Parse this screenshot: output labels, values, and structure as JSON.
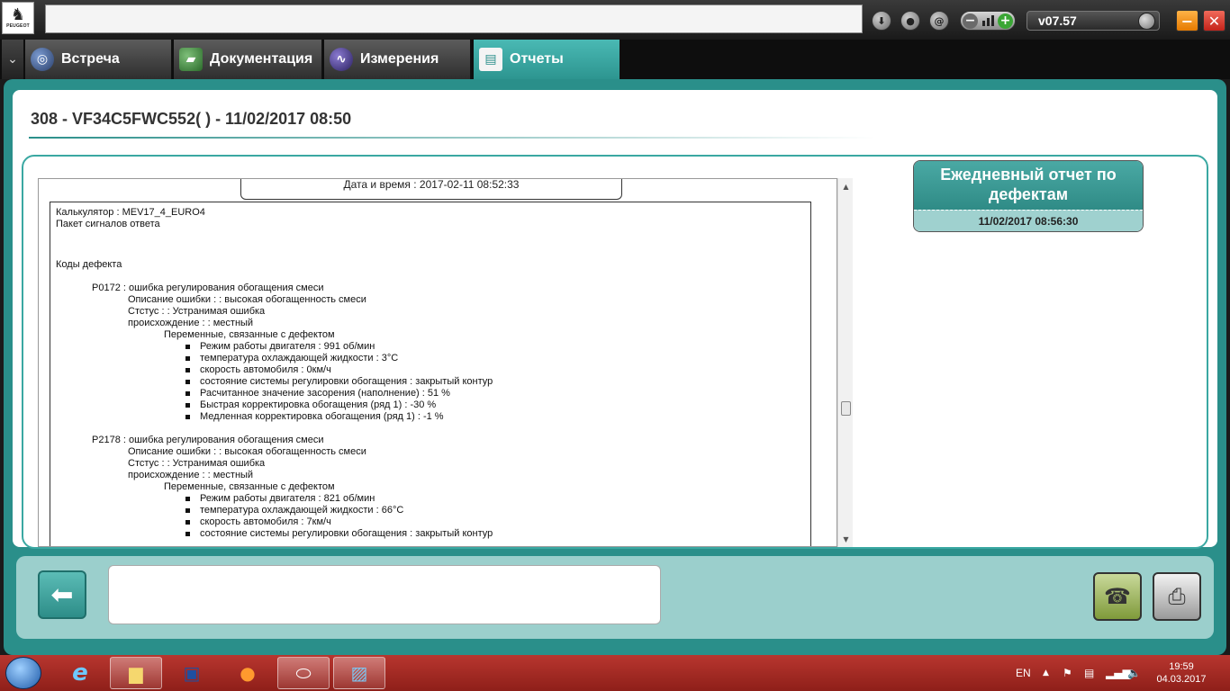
{
  "app": {
    "logo_text": "PEUGEOT",
    "version": "v07.57",
    "tabs": [
      {
        "label": "Встреча",
        "icon": "globe-icon"
      },
      {
        "label": "Документация",
        "icon": "book-icon"
      },
      {
        "label": "Измерения",
        "icon": "waveform-icon"
      },
      {
        "label": "Отчеты",
        "icon": "report-icon",
        "active": true
      }
    ]
  },
  "header": {
    "vehicle_title": "308 - VF34C5FWC552(      ) - 11/02/2017 08:50"
  },
  "report": {
    "datetime_label": "Дата и время : 2017-02-11 08:52:33",
    "calculator": "Калькулятор : MEV17_4_EURO4",
    "packet": "Пакет сигналов ответа",
    "codes_heading": "Коды дефекта",
    "faults": [
      {
        "title": "P0172 : ошибка регулирования обогащения смеси",
        "description": "Описание ошибки : : высокая обогащенность смеси",
        "status": "Стстус : : Устранимая ошибка",
        "origin": "происхождение : : местный",
        "vars_heading": "Переменные, связанные с дефектом",
        "vars": [
          "Режим работы двигателя : 991 об/мин",
          "температура охлаждающей жидкости : 3°C",
          "скорость автомобиля : 0км/ч",
          "состояние системы регулировки обогащения : закрытый контур",
          "Расчитанное значение засорения (наполнение) : 51 %",
          "Быстрая корректировка обогащения (ряд 1) : -30 %",
          "Медленная корректировка обогащения (ряд 1) : -1 %"
        ]
      },
      {
        "title": "P2178 : ошибка регулирования обогащения смеси",
        "description": "Описание ошибки : : высокая обогащенность смеси",
        "status": "Стстус : : Устранимая ошибка",
        "origin": "происхождение : : местный",
        "vars_heading": "Переменные, связанные с дефектом",
        "vars": [
          "Режим работы двигателя : 821 об/мин",
          "температура охлаждающей жидкости : 66°C",
          "скорость автомобиля : 7км/ч",
          "состояние системы регулировки обогащения : закрытый контур"
        ]
      }
    ]
  },
  "daily_card": {
    "title": "Ежедневный отчет по дефектам",
    "date": "11/02/2017 08:56:30"
  },
  "taskbar": {
    "language": "EN",
    "time": "19:59",
    "date": "04.03.2017"
  }
}
